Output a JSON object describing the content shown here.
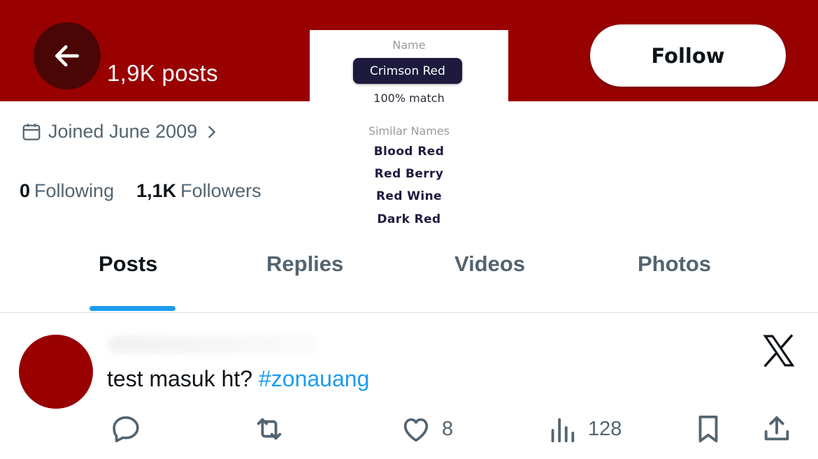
{
  "header": {
    "posts_count": "1,9K posts",
    "follow_label": "Follow",
    "bg_color": "#990000"
  },
  "color_panel": {
    "name_label": "Name",
    "color_name": "Crimson Red",
    "match": "100% match",
    "similar_label": "Similar Names",
    "similar": [
      "Blood Red",
      "Red Berry",
      "Red Wine",
      "Dark Red"
    ]
  },
  "profile": {
    "joined": "Joined June 2009",
    "following_count": "0",
    "following_label": "Following",
    "followers_count": "1,1K",
    "followers_label": "Followers"
  },
  "tabs": [
    {
      "label": "Posts",
      "active": true
    },
    {
      "label": "Replies",
      "active": false
    },
    {
      "label": "Videos",
      "active": false
    },
    {
      "label": "Photos",
      "active": false
    }
  ],
  "post": {
    "text": "test masuk ht? ",
    "hashtag": "#zonauang",
    "likes": "8",
    "views": "128"
  },
  "icons": [
    "back-arrow-icon",
    "calendar-icon",
    "chevron-right-icon",
    "x-logo-icon",
    "reply-icon",
    "repost-icon",
    "heart-icon",
    "analytics-icon",
    "bookmark-icon",
    "share-icon"
  ],
  "colors": {
    "accent": "#1d9bf0",
    "brand_red": "#990000",
    "muted": "#536471",
    "pill": "#1d1a3e"
  }
}
